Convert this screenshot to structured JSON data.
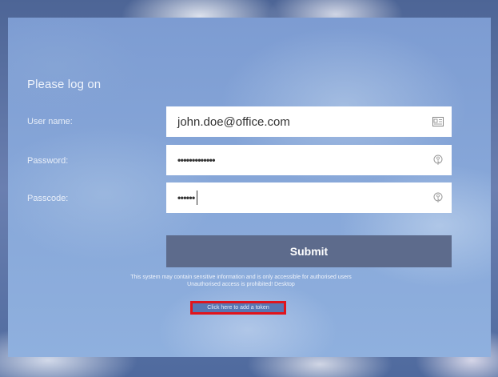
{
  "form": {
    "heading": "Please log on",
    "username_label": "User name:",
    "password_label": "Password:",
    "passcode_label": "Passcode:",
    "username_value": "john.doe@office.com",
    "password_value": "•••••••••••••",
    "passcode_value": "••••••",
    "submit_label": "Submit"
  },
  "notice": {
    "line1": "This system may contain sensitive information and is only accessible for authorised users",
    "line2": "Unauthorised access is prohibited! Desktop"
  },
  "token_link": "Click here to add a token",
  "icons": {
    "username": "contact-card-icon",
    "password": "key-icon",
    "passcode": "key-icon"
  },
  "colors": {
    "panel": "#86a6d8",
    "submit": "#5d6b8c",
    "highlight": "#e0141c"
  }
}
